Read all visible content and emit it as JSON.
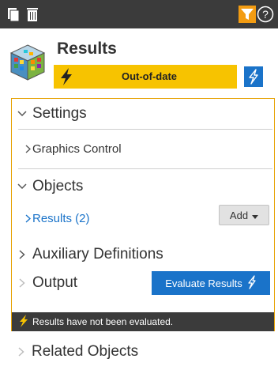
{
  "toolbar": {
    "icons": [
      "copy-icon",
      "trash-icon",
      "filter-icon",
      "help-icon"
    ],
    "help_glyph": "?",
    "background": "#3b3b3b",
    "filter_color": "#f39c12"
  },
  "header": {
    "title": "Results",
    "status_text": "Out-of-date",
    "status_color": "#f7c300",
    "accent_color": "#1a73c9"
  },
  "settings": {
    "label": "Settings",
    "items": [
      {
        "label": "Graphics Control"
      }
    ]
  },
  "objects": {
    "label": "Objects",
    "results_link": "Results (2)",
    "add_label": "Add"
  },
  "auxiliary": {
    "label": "Auxiliary Definitions"
  },
  "output": {
    "label": "Output",
    "evaluate_label": "Evaluate Results"
  },
  "footer": {
    "message": "Results have not been evaluated."
  },
  "related": {
    "label": "Related Objects"
  }
}
